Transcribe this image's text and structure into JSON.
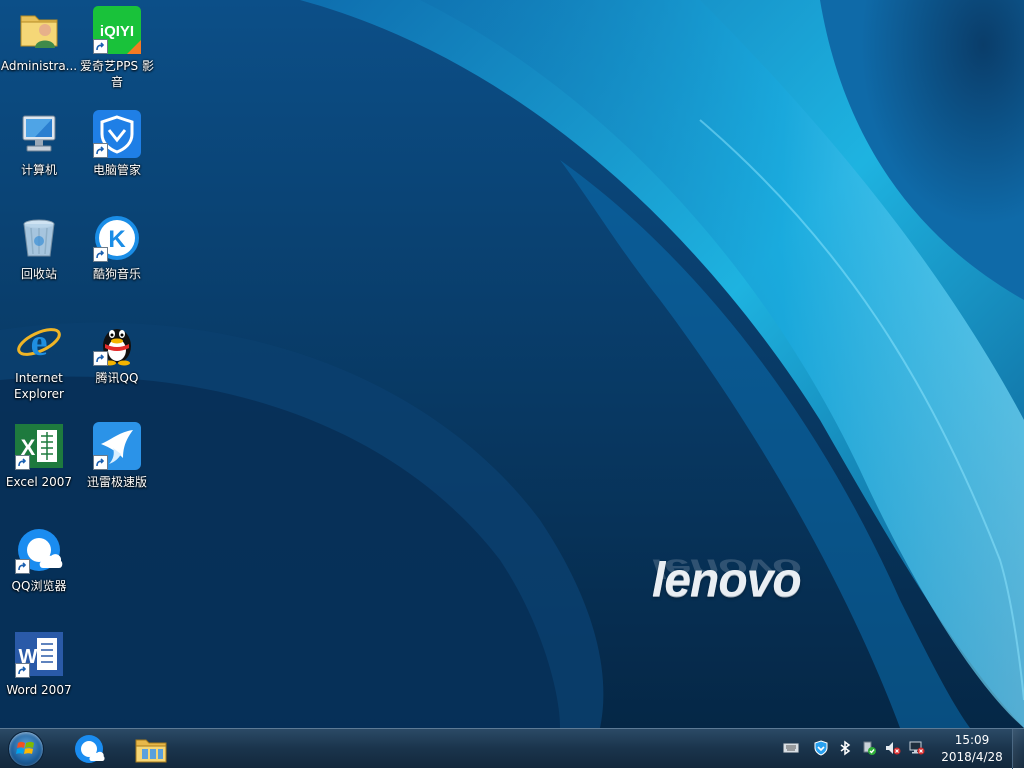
{
  "wallpaper": {
    "brand": "lenovo",
    "colors": {
      "deep": "#04243f",
      "mid": "#0a5a9a",
      "bright": "#1fb9e6",
      "glow": "#7fe3ff"
    }
  },
  "desktop_icons": [
    {
      "label": "Administra...",
      "icon": "user-folder-icon",
      "shortcut": false
    },
    {
      "label": "爱奇艺PPS 影音",
      "icon": "iqiyi-icon",
      "shortcut": true,
      "logo_text": "iQIYI"
    },
    {
      "label": "计算机",
      "icon": "computer-icon",
      "shortcut": false
    },
    {
      "label": "电脑管家",
      "icon": "tencent-pc-manager-icon",
      "shortcut": true
    },
    {
      "label": "回收站",
      "icon": "recycle-bin-icon",
      "shortcut": false
    },
    {
      "label": "酷狗音乐",
      "icon": "kugou-music-icon",
      "shortcut": true,
      "logo_text": "K"
    },
    {
      "label": "Internet Explorer",
      "icon": "internet-explorer-icon",
      "shortcut": false
    },
    {
      "label": "腾讯QQ",
      "icon": "qq-penguin-icon",
      "shortcut": true
    },
    {
      "label": "Excel 2007",
      "icon": "excel-icon",
      "shortcut": true,
      "logo_text": "X"
    },
    {
      "label": "迅雷极速版",
      "icon": "xunlei-icon",
      "shortcut": true
    },
    {
      "label": "QQ浏览器",
      "icon": "qq-browser-icon",
      "shortcut": true
    },
    {
      "label": "Word 2007",
      "icon": "word-icon",
      "shortcut": true,
      "logo_text": "W"
    }
  ],
  "taskbar": {
    "start_button": "windows-start-icon",
    "pinned": [
      "qq-browser-icon",
      "file-explorer-icon"
    ],
    "tray": [
      "keyboard-icon",
      "tencent-pc-manager-icon",
      "bluetooth-icon",
      "safely-remove-hardware-icon",
      "volume-muted-icon",
      "network-disconnected-icon"
    ],
    "clock": {
      "time": "15:09",
      "date": "2018/4/28"
    }
  }
}
